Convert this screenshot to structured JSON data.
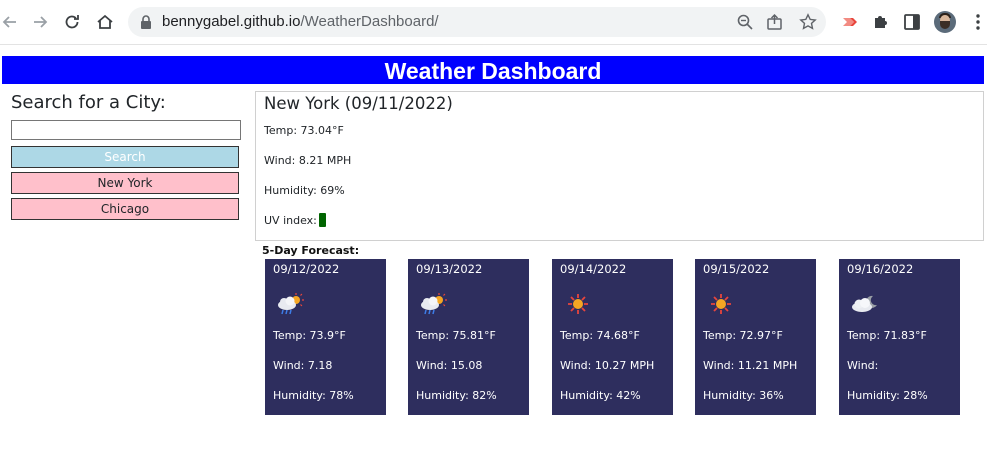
{
  "browser": {
    "url_host": "bennygabel.github.io",
    "url_path": "/WeatherDashboard/"
  },
  "header": {
    "title": "Weather Dashboard"
  },
  "search": {
    "title": "Search for a City:",
    "input_value": "",
    "button_label": "Search",
    "history": [
      "New York",
      "Chicago"
    ]
  },
  "current": {
    "title": "New York (09/11/2022)",
    "temp": "Temp: 73.04°F",
    "wind": "Wind: 8.21 MPH",
    "humidity": "Humidity: 69%",
    "uv_label": "UV index:",
    "uv_color": "#006400"
  },
  "forecast": {
    "title": "5-Day Forecast:",
    "days": [
      {
        "date": "09/12/2022",
        "icon": "rain-sun-icon",
        "temp": "Temp: 73.9°F",
        "wind": "Wind: 7.18",
        "humidity": "Humidity: 78%"
      },
      {
        "date": "09/13/2022",
        "icon": "rain-sun-icon",
        "temp": "Temp: 75.81°F",
        "wind": "Wind: 15.08",
        "humidity": "Humidity: 82%"
      },
      {
        "date": "09/14/2022",
        "icon": "sun-icon",
        "temp": "Temp: 74.68°F",
        "wind": "Wind: 10.27 MPH",
        "humidity": "Humidity: 42%"
      },
      {
        "date": "09/15/2022",
        "icon": "sun-icon",
        "temp": "Temp: 72.97°F",
        "wind": "Wind: 11.21 MPH",
        "humidity": "Humidity: 36%"
      },
      {
        "date": "09/16/2022",
        "icon": "cloud-moon-icon",
        "temp": "Temp: 71.83°F",
        "wind": "Wind:",
        "humidity": "Humidity: 28%"
      }
    ]
  },
  "colors": {
    "header_bg": "#0000ff",
    "search_button_bg": "#add8e6",
    "history_button_bg": "#ffc0cb",
    "card_bg": "#2e2e5e"
  }
}
